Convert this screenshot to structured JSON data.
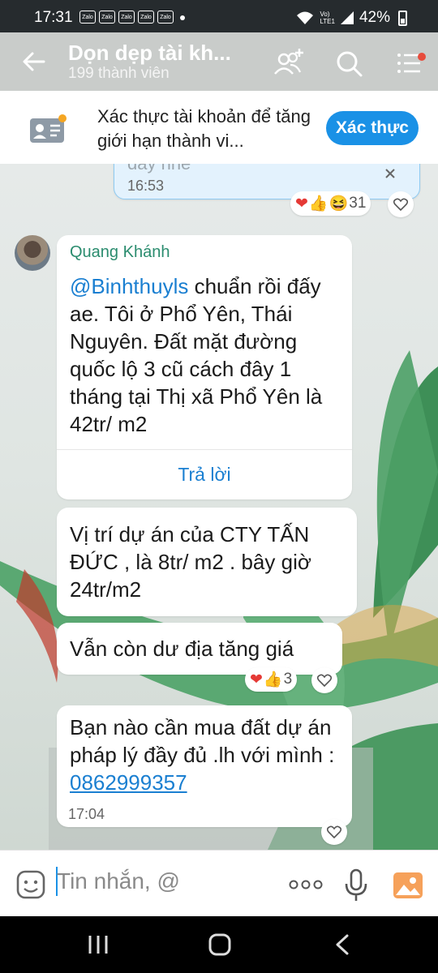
{
  "status_bar": {
    "time": "17:31",
    "notification_badges": [
      "Zalo",
      "Zalo",
      "Zalo",
      "Zalo",
      "Zalo"
    ],
    "network_label_top": "Vo)",
    "network_label_bottom": "LTE1",
    "battery_percent": "42%"
  },
  "header": {
    "title": "Dọn dẹp tài kh...",
    "subtitle": "199 thành viên"
  },
  "banner": {
    "text": "Xác thực tài khoản để tăng giới hạn thành vi...",
    "button_label": "Xác thực"
  },
  "messages": {
    "own": {
      "partial_text": "đây nhé",
      "time": "16:53",
      "reaction_count": "31"
    },
    "m1": {
      "sender": "Quang Khánh",
      "mention": "@Binhthuyls",
      "text": " chuẩn rồi đấy ae. Tôi ở Phổ Yên, Thái Nguyên. Đất mặt đường quốc lộ 3 cũ cách đây 1 tháng tại Thị xã Phổ Yên là 42tr/ m2",
      "reply_label": "Trả lời"
    },
    "m2": {
      "text": "Vị trí dự án của CTY TẤN ĐỨC , là 8tr/ m2 . bây giờ 24tr/m2"
    },
    "m3": {
      "text": "Vẫn còn dư địa tăng giá",
      "reaction_count": "3"
    },
    "m4": {
      "text": "Bạn nào cần mua đất dự án pháp lý đầy đủ .lh với mình : ",
      "phone": "0862999357",
      "time": "17:04"
    }
  },
  "input": {
    "placeholder": "Tin nhắn, @"
  },
  "colors": {
    "accent": "#1a91e6",
    "header_bg": "#c9ccca",
    "sender_name": "#2a8c6e"
  }
}
